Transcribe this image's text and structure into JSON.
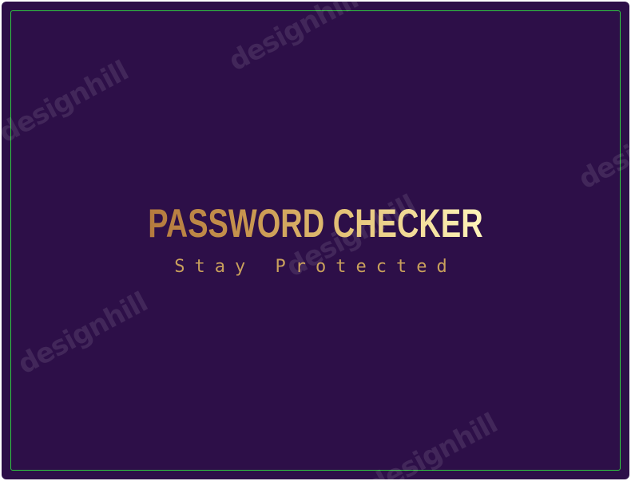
{
  "logo": {
    "title": "PASSWORD CHECKER",
    "tagline": "Stay Protected"
  },
  "watermarks": [
    "designhill",
    "designhill",
    "designhill",
    "designhill",
    "designhill",
    "designhill"
  ],
  "colors": {
    "background": "#2d0f48",
    "frame": "#2ecc40",
    "gold_dark": "#b47a3e",
    "gold_light": "#fff4ba"
  }
}
